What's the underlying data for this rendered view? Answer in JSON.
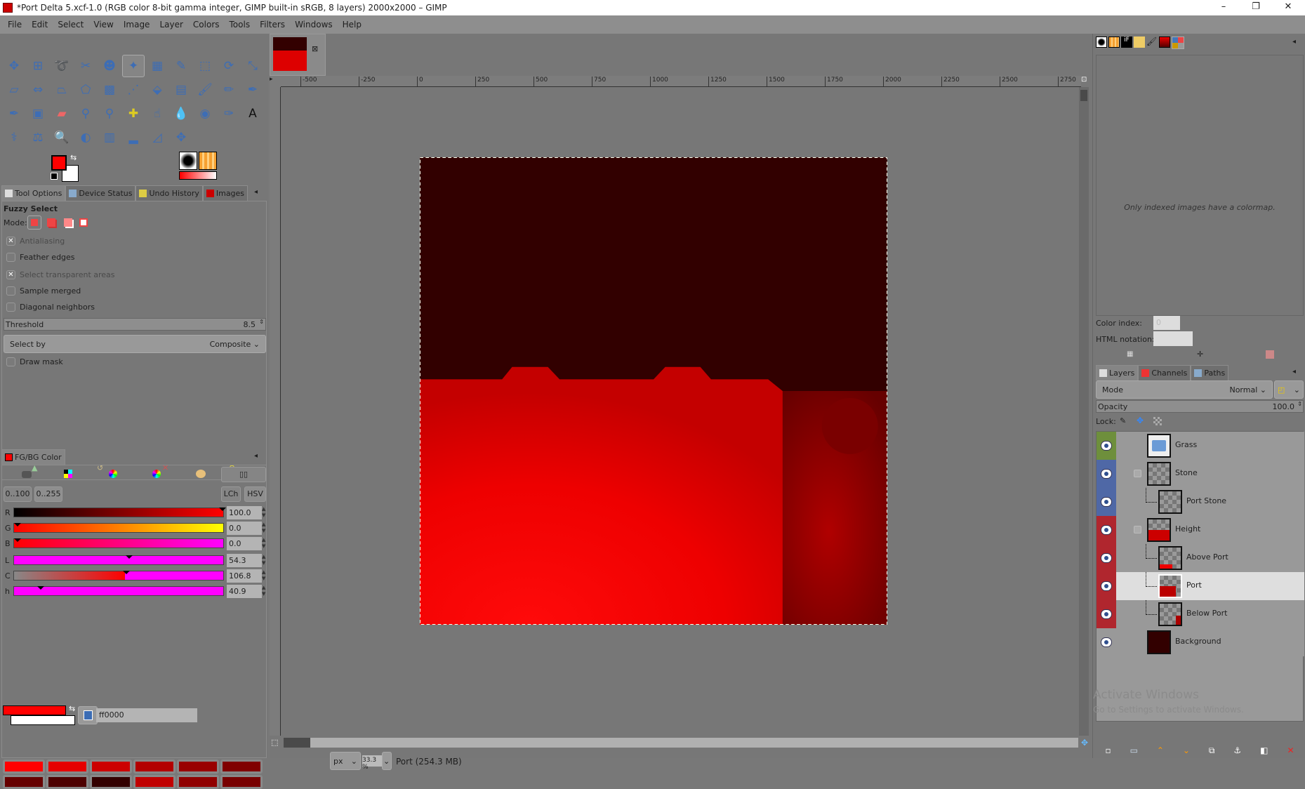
{
  "window": {
    "title": "*Port Delta 5.xcf-1.0 (RGB color 8-bit gamma integer, GIMP built-in sRGB, 8 layers) 2000x2000 – GIMP",
    "min": "–",
    "max": "❐",
    "close": "✕"
  },
  "menu": [
    "File",
    "Edit",
    "Select",
    "View",
    "Image",
    "Layer",
    "Colors",
    "Tools",
    "Filters",
    "Windows",
    "Help"
  ],
  "toolbox": {
    "tools": [
      "move",
      "align",
      "free-select",
      "scissors-select",
      "foreground-select",
      "fuzzy-select",
      "select-by-color",
      "crop",
      "unified-transform",
      "rotate",
      "scale",
      "shear",
      "flip",
      "perspective",
      "cage-transform",
      "warp-transform",
      "handle-transform",
      "bucket-fill",
      "gradient",
      "paintbrush",
      "pencil",
      "airbrush",
      "ink",
      "mypaint-brush",
      "eraser",
      "clone",
      "perspective-clone",
      "heal",
      "smudge",
      "blur-sharpen",
      "dodge-burn",
      "paths",
      "text",
      "color-picker",
      "measure",
      "zoom",
      "brightness-contrast",
      "color-balance",
      "levels",
      "curves",
      "move-selection"
    ],
    "active": 5,
    "fg": "#ff0000",
    "bg": "#ffffff"
  },
  "left_tabs": [
    "Tool Options",
    "Device Status",
    "Undo History",
    "Images"
  ],
  "tool_options": {
    "title": "Fuzzy Select",
    "mode_label": "Mode:",
    "antialiasing": "Antialiasing",
    "feather": "Feather edges",
    "transparent": "Select transparent areas",
    "sample_merged": "Sample merged",
    "diagonal": "Diagonal neighbors",
    "threshold_label": "Threshold",
    "threshold": "8.5",
    "select_by_label": "Select by",
    "select_by": "Composite",
    "draw_mask": "Draw mask",
    "checked": {
      "antialiasing": true,
      "feather": false,
      "transparent": true,
      "sample_merged": false,
      "diagonal": false,
      "draw_mask": false
    }
  },
  "fgbg": {
    "tab": "FG/BG Color",
    "range1": "0..100",
    "range2": "0..255",
    "lch": "LCh",
    "hsv": "HSV",
    "channels": [
      {
        "label": "R",
        "value": "100.0"
      },
      {
        "label": "G",
        "value": "0.0"
      },
      {
        "label": "B",
        "value": "0.0"
      },
      {
        "label": "L",
        "value": "54.3"
      },
      {
        "label": "C",
        "value": "106.8"
      },
      {
        "label": "h",
        "value": "40.9"
      }
    ],
    "hex": "ff0000",
    "palette": [
      "#ff0000",
      "#e60000",
      "#cc0000",
      "#b30000",
      "#990000",
      "#800000",
      "#660000",
      "#4d0000",
      "#330000",
      "#c00000",
      "#900000",
      "#780000"
    ]
  },
  "canvas": {
    "ruler": [
      "-500",
      "-250",
      "0",
      "250",
      "500",
      "750",
      "1000",
      "1250",
      "1500",
      "1750",
      "2000",
      "2250",
      "2500",
      "2750"
    ],
    "unit": "px",
    "zoom": "33.3 %",
    "status": "Port (254.3 MB)"
  },
  "colormap": {
    "message": "Only indexed images have a colormap.",
    "color_index_label": "Color index:",
    "color_index": "0",
    "html_label": "HTML notation:"
  },
  "layers": {
    "tabs": [
      "Layers",
      "Channels",
      "Paths"
    ],
    "mode_label": "Mode",
    "mode": "Normal",
    "opacity_label": "Opacity",
    "opacity": "100.0",
    "lock_label": "Lock:",
    "items": [
      {
        "name": "Grass",
        "tag": "#6e8f3c",
        "indent": 0,
        "group": true
      },
      {
        "name": "Stone",
        "tag": "#4f68a6",
        "indent": 0,
        "expander": true
      },
      {
        "name": "Port Stone",
        "tag": "#4f68a6",
        "indent": 1
      },
      {
        "name": "Height",
        "tag": "#b0262e",
        "indent": 0,
        "expander": true
      },
      {
        "name": "Above Port",
        "tag": "#b0262e",
        "indent": 1
      },
      {
        "name": "Port",
        "tag": "#b0262e",
        "indent": 1,
        "selected": true
      },
      {
        "name": "Below Port",
        "tag": "#b0262e",
        "indent": 1
      },
      {
        "name": "Background",
        "tag": "",
        "indent": 0
      }
    ]
  },
  "watermark": {
    "line1": "Activate Windows",
    "line2": "Go to Settings to activate Windows."
  }
}
